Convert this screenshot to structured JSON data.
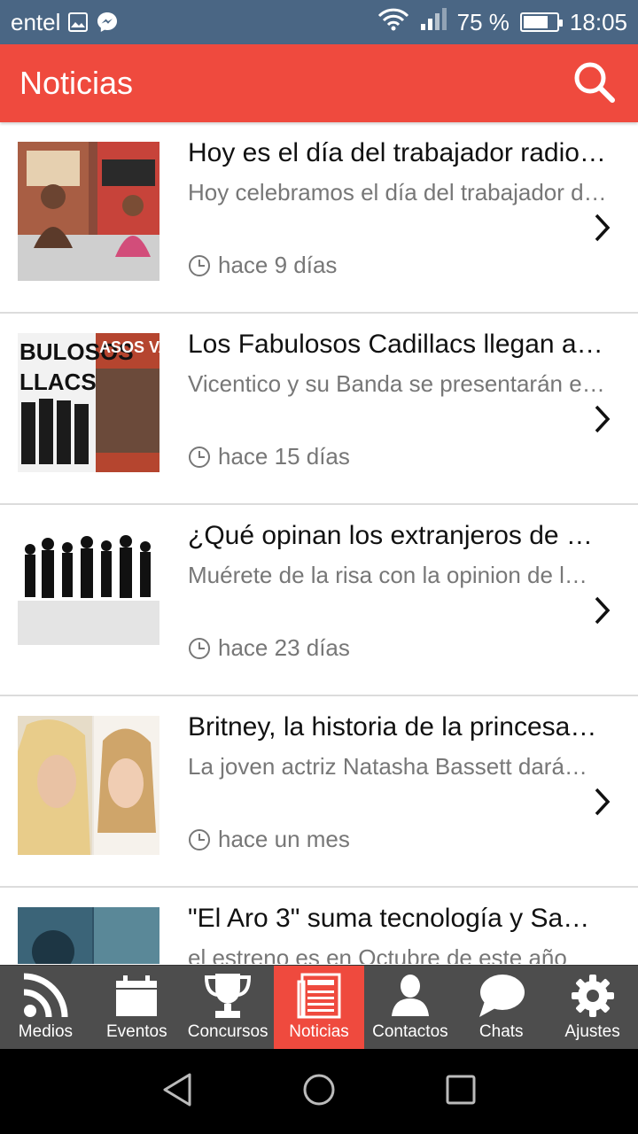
{
  "status_bar": {
    "carrier": "entel",
    "battery_percent_label": "75 %",
    "battery_level": 0.75,
    "time": "18:05",
    "icons": [
      "image-icon",
      "messenger-icon",
      "wifi-icon",
      "signal-icon",
      "battery-icon"
    ]
  },
  "app_bar": {
    "title": "Noticias",
    "search_icon": "search-icon"
  },
  "news": [
    {
      "title": "Hoy es el día del trabajador radio…",
      "summary": "Hoy celebramos el día del trabajador de la radio",
      "time": "hace 9 días",
      "thumb": "radio-studio"
    },
    {
      "title": "Los Fabulosos Cadillacs llegan a…",
      "summary": "Vicentico y su Banda se presentarán en …",
      "time": "hace 15 días",
      "thumb": "band-poster"
    },
    {
      "title": "¿Qué opinan los extranjeros de n…",
      "summary": "Muérete de la risa con la opinion de l…",
      "time": "hace 23 días",
      "thumb": "silhouettes"
    },
    {
      "title": "Britney, la historia de la princesa…",
      "summary": "La joven actriz Natasha Bassett dará…",
      "time": "hace un mes",
      "thumb": "two-women"
    },
    {
      "title": "\"El Aro 3\" suma tecnología y Sa…",
      "summary": "el estreno es en Octubre de este año",
      "time": "",
      "thumb": "movie-poster"
    }
  ],
  "bottom_nav": [
    {
      "label": "Medios",
      "icon": "rss-icon",
      "active": false
    },
    {
      "label": "Eventos",
      "icon": "calendar-icon",
      "active": false
    },
    {
      "label": "Concursos",
      "icon": "trophy-icon",
      "active": false
    },
    {
      "label": "Noticias",
      "icon": "newspaper-icon",
      "active": true
    },
    {
      "label": "Contactos",
      "icon": "person-icon",
      "active": false
    },
    {
      "label": "Chats",
      "icon": "chat-bubble-icon",
      "active": false
    },
    {
      "label": "Ajustes",
      "icon": "gear-icon",
      "active": false
    }
  ],
  "colors": {
    "status_bar": "#4a6684",
    "accent": "#ef4a3e",
    "nav_bg": "#4d4d4d",
    "secondary_text": "#777777"
  }
}
